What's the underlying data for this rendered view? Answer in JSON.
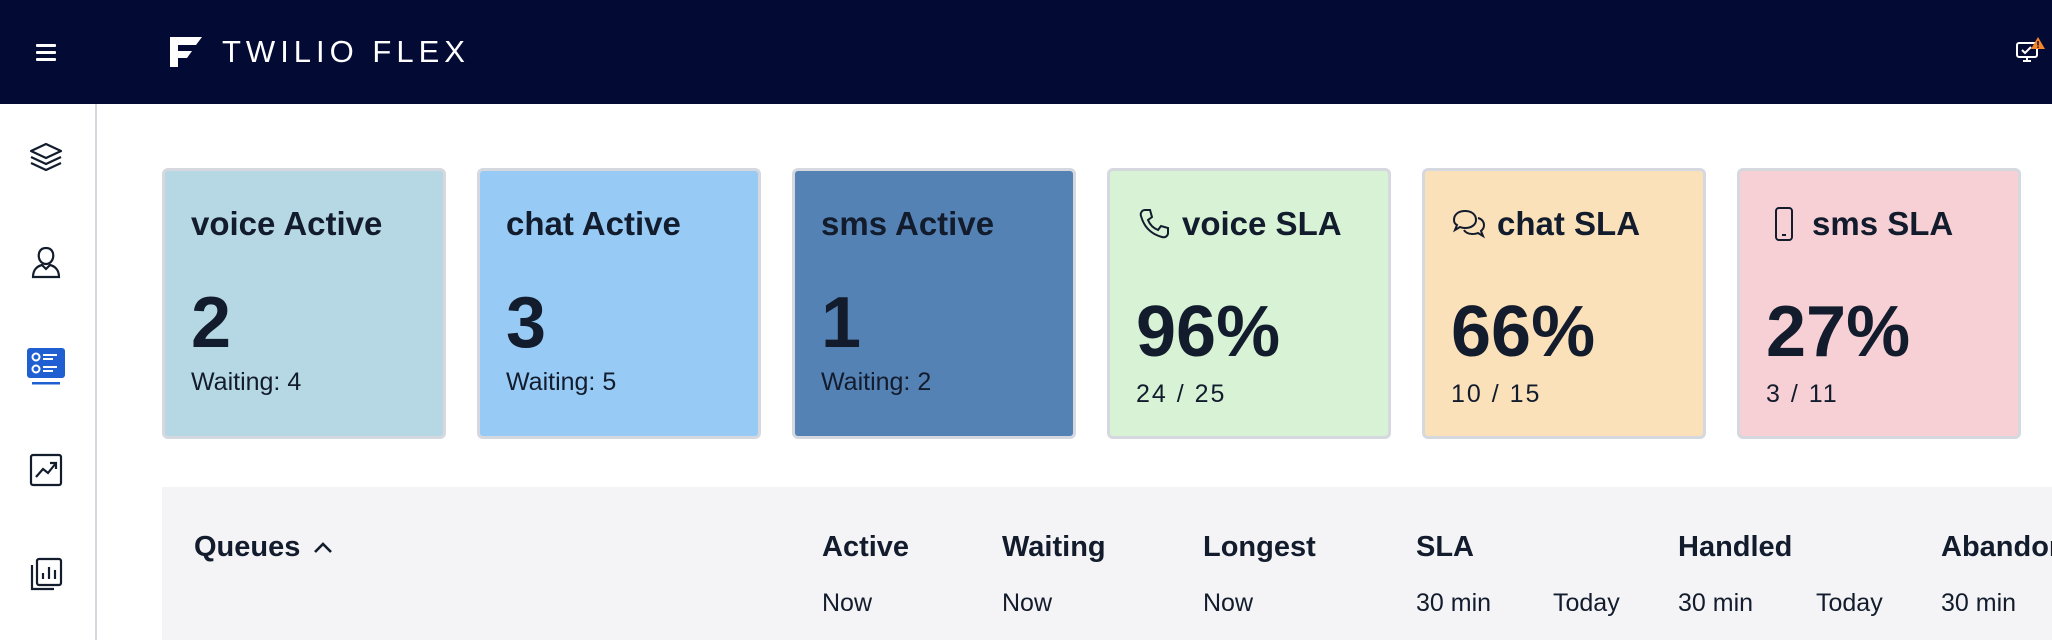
{
  "header": {
    "brand": "TWILIO FLEX"
  },
  "colors": {
    "topbar": "#030b35",
    "voice_active": "#b6d8e4",
    "chat_active": "#97cbf5",
    "sms_active": "#5582b4",
    "voice_sla": "#d7f2d4",
    "chat_sla": "#fbe1ba",
    "sms_sla": "#f7d0d5",
    "sidebar_active": "#1f5fd1"
  },
  "sidebar": {
    "items": [
      {
        "name": "layers-icon"
      },
      {
        "name": "agents-icon"
      },
      {
        "name": "queues-dashboard-icon",
        "active": true
      },
      {
        "name": "analytics-icon"
      },
      {
        "name": "reports-icon"
      }
    ]
  },
  "tiles": [
    {
      "title": "voice Active",
      "value": "2",
      "sub": "Waiting: 4"
    },
    {
      "title": "chat Active",
      "value": "3",
      "sub": "Waiting: 5"
    },
    {
      "title": "sms Active",
      "value": "1",
      "sub": "Waiting: 2"
    },
    {
      "title": "voice SLA",
      "value": "96%",
      "sub": "24 / 25",
      "icon": "phone-icon"
    },
    {
      "title": "chat SLA",
      "value": "66%",
      "sub": "10 / 15",
      "icon": "chat-icon"
    },
    {
      "title": "sms SLA",
      "value": "27%",
      "sub": "3 / 11",
      "icon": "mobile-icon"
    }
  ],
  "queues": {
    "title": "Queues",
    "columns": {
      "active": "Active",
      "waiting": "Waiting",
      "longest": "Longest",
      "sla": "SLA",
      "handled": "Handled",
      "abandoned": "Abandoned"
    },
    "sub": {
      "active_now": "Now",
      "waiting_now": "Now",
      "longest_now": "Now",
      "sla_30": "30 min",
      "sla_today": "Today",
      "handled_30": "30 min",
      "handled_today": "Today",
      "abandoned_30": "30 min"
    }
  }
}
